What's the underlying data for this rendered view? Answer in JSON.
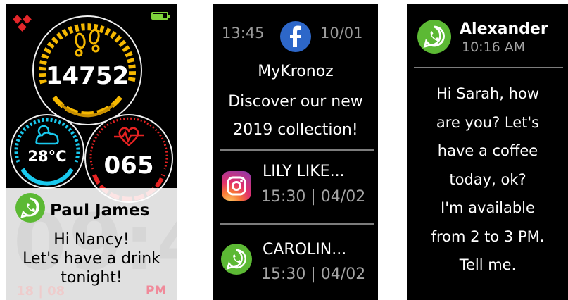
{
  "screen1": {
    "logo_icon": "kronoz-logo-icon",
    "battery_level": 0.8,
    "steps": "14752",
    "temperature": "28°C",
    "heart_rate": "065",
    "notification": {
      "app_icon": "whatsapp-icon",
      "sender": "Paul James",
      "message_line1": "Hi Nancy!",
      "message_line2": "Let's have a drink",
      "message_line3": "tonight!"
    },
    "background_time": "09:45",
    "date": "18 | 08",
    "ampm": "PM"
  },
  "screen2": {
    "time": "13:45",
    "app_icon": "facebook-icon",
    "date": "10/01",
    "title": "MyKronoz",
    "body_line1": "Discover our new",
    "body_line2": "2019 collection!",
    "items": [
      {
        "app_icon": "instagram-icon",
        "name": "LILY LIKE...",
        "meta": "15:30 | 04/02"
      },
      {
        "app_icon": "whatsapp-icon",
        "name": "CAROLIN...",
        "meta": "15:30 | 04/02"
      }
    ]
  },
  "screen3": {
    "app_icon": "whatsapp-icon",
    "sender": "Alexander",
    "time": "10:16 AM",
    "message_lines": [
      "Hi Sarah, how",
      "are you? Let's",
      "have a coffee",
      "today, ok?",
      "I'm available",
      "from 2 to 3 PM.",
      "Tell me."
    ]
  },
  "colors": {
    "whatsapp_green": "#5cb934",
    "facebook_blue": "#2d67c9",
    "steps_yellow": "#f5b800",
    "weather_cyan": "#19c9ee",
    "heart_red": "#e52222",
    "battery_green": "#7fd43b"
  }
}
